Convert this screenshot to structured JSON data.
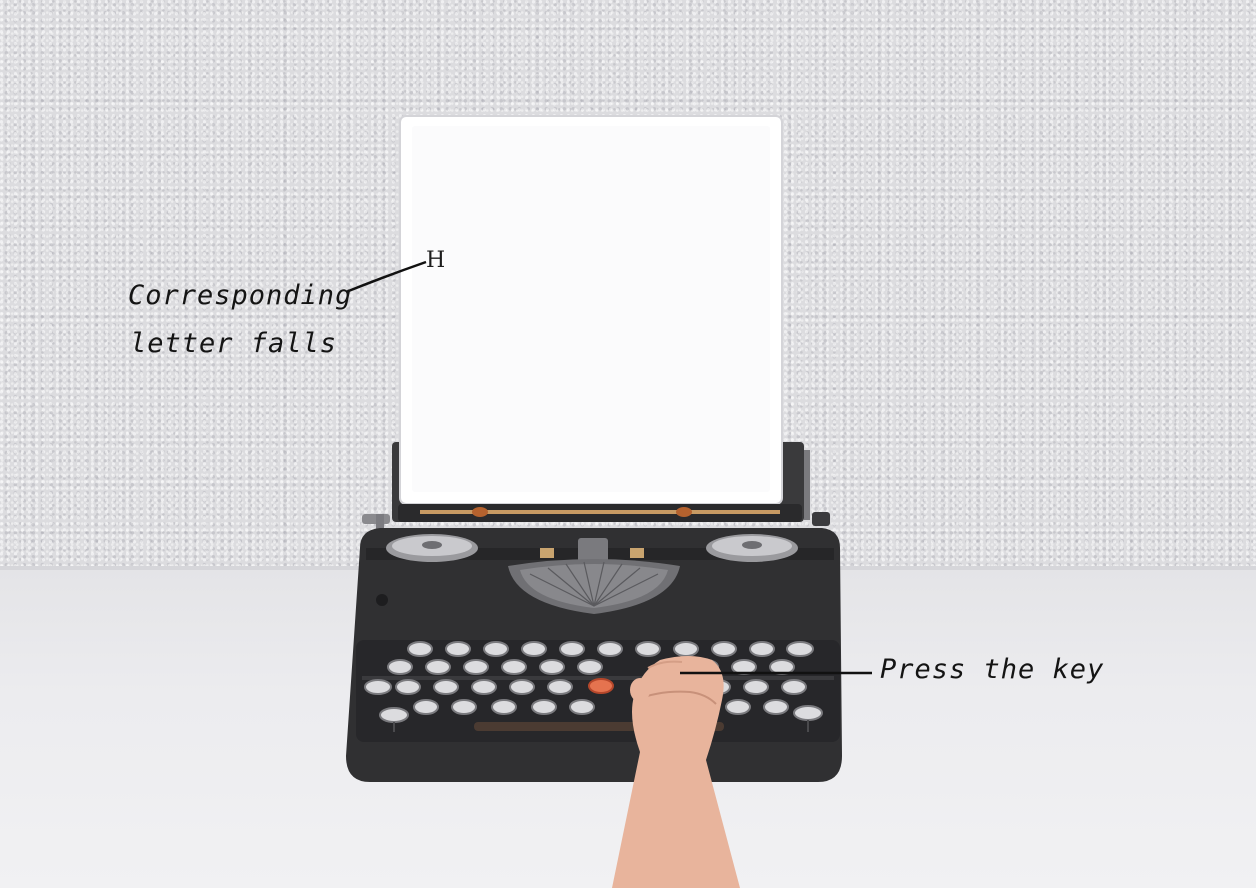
{
  "paper": {
    "typed_letter": "H"
  },
  "annotations": {
    "letter_falls_line1": "Corresponding",
    "letter_falls_line2": "letter falls",
    "press_key": "Press the key"
  },
  "colors": {
    "wall": "#dcdcdf",
    "table": "#ececef",
    "typewriter_body": "#2f2f31",
    "paper": "#ffffff",
    "pressed_key": "#e5734f",
    "skin": "#e8b49c"
  }
}
